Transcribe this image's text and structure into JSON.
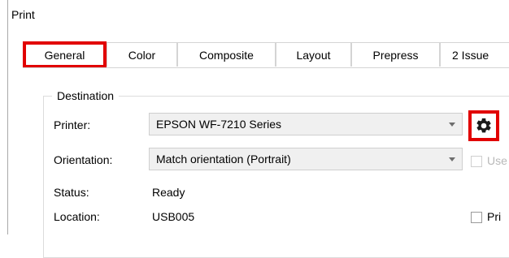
{
  "window": {
    "title": "Print"
  },
  "tabs": [
    {
      "label": "General"
    },
    {
      "label": "Color"
    },
    {
      "label": "Composite"
    },
    {
      "label": "Layout"
    },
    {
      "label": "Prepress"
    },
    {
      "label": "2 Issue"
    }
  ],
  "destination": {
    "legend": "Destination",
    "printer_label": "Printer:",
    "printer_value": "EPSON WF-7210 Series",
    "orientation_label": "Orientation:",
    "orientation_value": "Match orientation (Portrait)",
    "status_label": "Status:",
    "status_value": "Ready",
    "location_label": "Location:",
    "location_value": "USB005",
    "use_checkbox_label": "Use",
    "print_checkbox_label": "Pri"
  },
  "colors": {
    "highlight": "#e10000"
  },
  "icons": {
    "settings": "gear-icon"
  }
}
